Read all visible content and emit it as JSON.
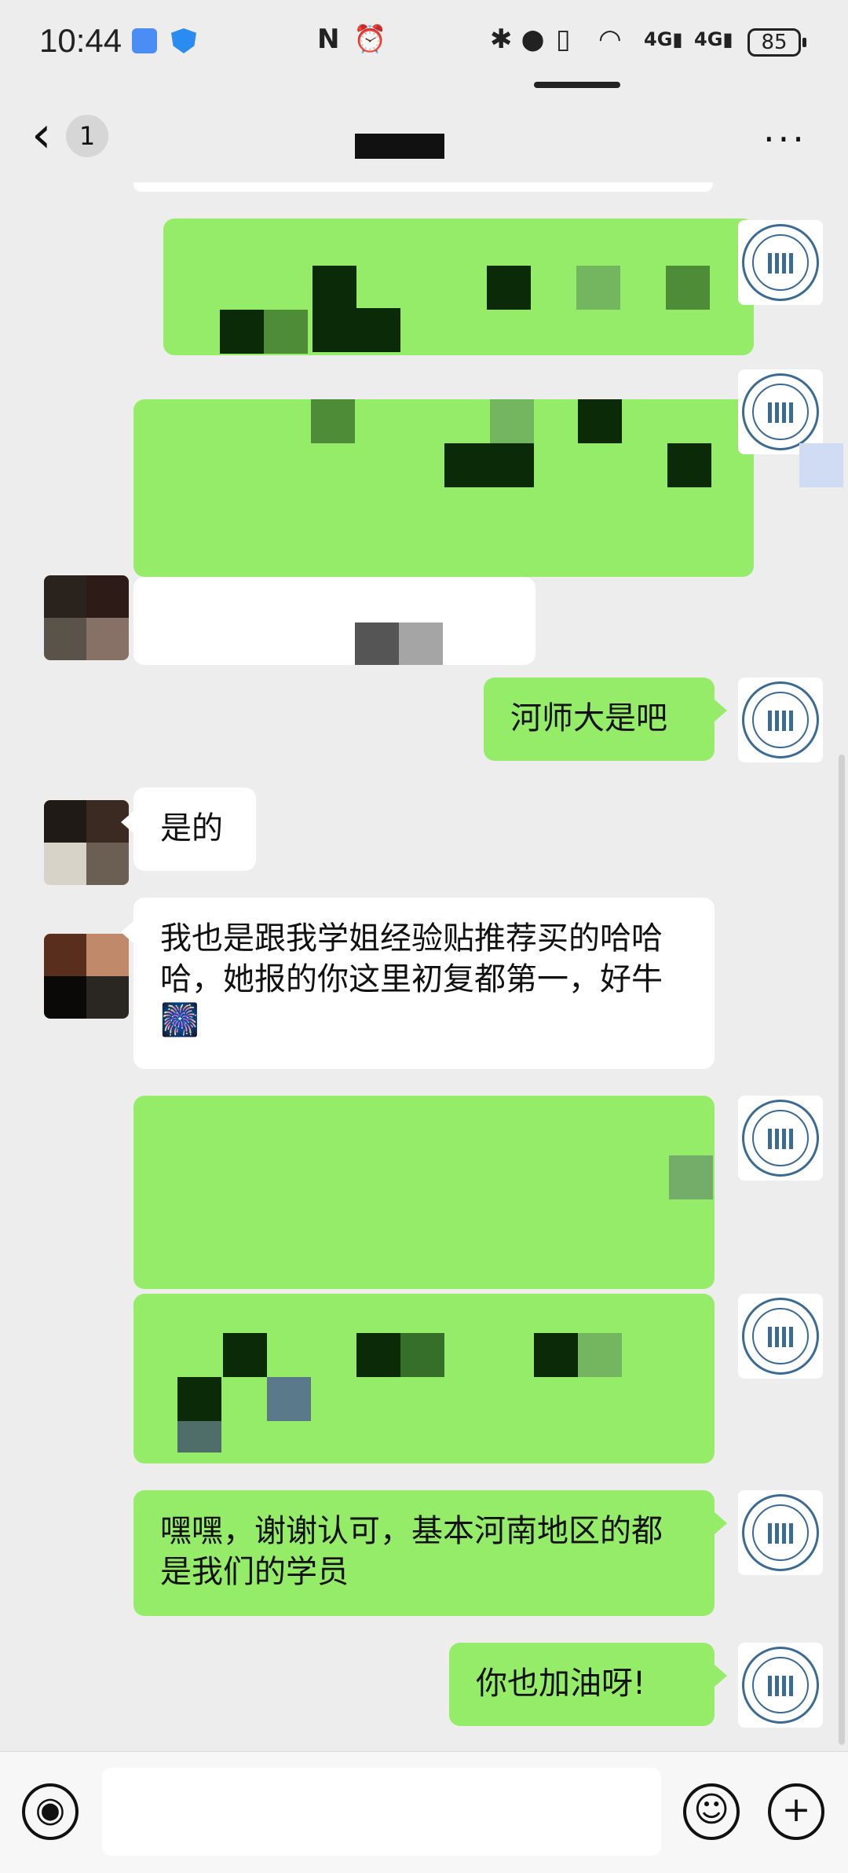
{
  "status_bar": {
    "time": "10:44",
    "left_icons": [
      "calendar-icon",
      "shield-icon"
    ],
    "nfc": "N",
    "alarm": "⏰",
    "bluetooth": "✱",
    "location": "⬤",
    "vibrate": "▯",
    "wifi": "◠",
    "signal1": "4G▮",
    "signal2": "4G▮",
    "battery": "85"
  },
  "top_nav": {
    "back_icon": "‹",
    "unread_count": "1",
    "more_icon": "···"
  },
  "messages": [
    {
      "side": "other",
      "text": "是的"
    },
    {
      "side": "other",
      "text": "我也是跟我学姐经验贴推荐买的哈哈哈，她报的你这里初复都第一，好牛🎆"
    },
    {
      "side": "me",
      "text": "河师大是吧"
    },
    {
      "side": "me",
      "text": "嘿嘿，谢谢认可，基本河南地区的都是我们的学员"
    },
    {
      "side": "me",
      "text": "你也加油呀!"
    }
  ],
  "bottom_bar": {
    "voice_icon": "◉",
    "emoji_icon": "☺",
    "add_icon": "+"
  },
  "colors": {
    "background": "#ededed",
    "my_bubble": "#95ec69",
    "other_bubble": "#ffffff"
  }
}
